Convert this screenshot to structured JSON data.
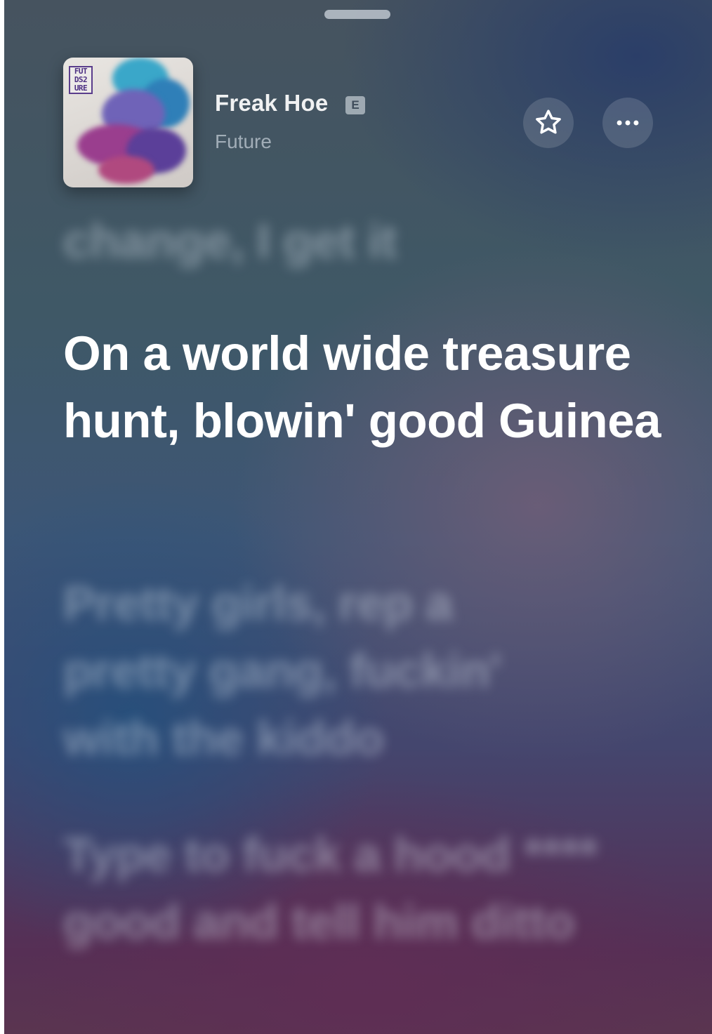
{
  "track": {
    "title": "Freak Hoe",
    "explicit_badge": "E",
    "artist": "Future",
    "album_art_text": [
      "FUT",
      "DS2",
      "URE"
    ]
  },
  "icons": {
    "favorite": "star-outline-icon",
    "more": "ellipsis-icon"
  },
  "lyrics": {
    "previous": "change, I get it",
    "current": "On a world wide treasure hunt, blowin' good Guinea",
    "next": [
      "Pretty girls, rep a pretty gang, fuckin' with the kiddo",
      "Type to fuck a hood **** good and tell him ditto"
    ]
  },
  "colors": {
    "active_lyric": "#ffffff",
    "inactive_lyric": "rgba(220,228,238,0.42)",
    "album_logo": "#4c2f82"
  }
}
